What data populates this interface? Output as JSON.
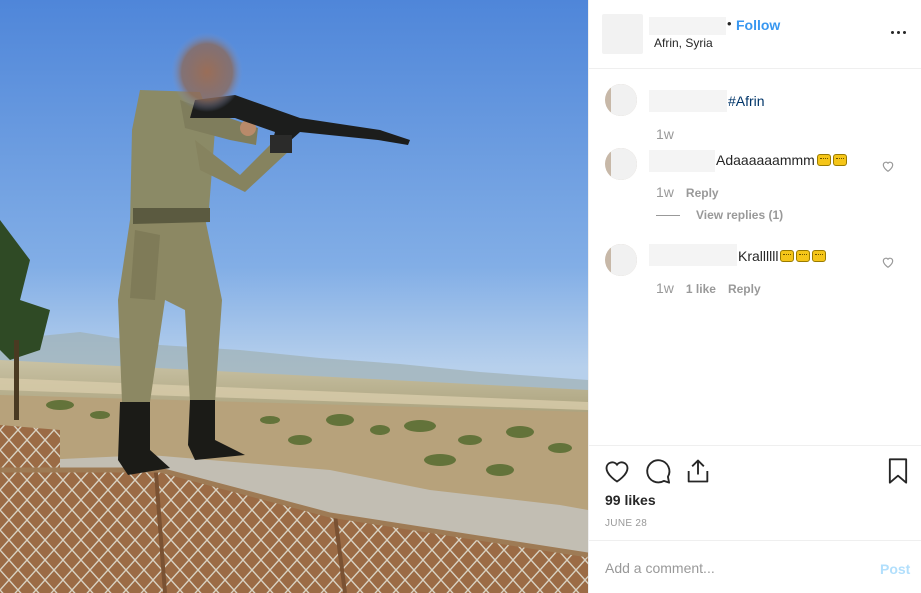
{
  "post": {
    "image": {
      "description_icon": "photo"
    }
  },
  "header": {
    "separator": "•",
    "follow_label": "Follow",
    "location": "Afrin, Syria",
    "more_icon": "more-horizontal-icon"
  },
  "comments": [
    {
      "text": "#Afrin",
      "time": "1w"
    },
    {
      "text": "Adaaaaaammm",
      "emoji_count": 2,
      "time": "1w",
      "reply_label": "Reply",
      "view_replies_label": "View replies (1)"
    },
    {
      "text": "Krallllll",
      "emoji_count": 3,
      "time": "1w",
      "likes_label": "1 like",
      "reply_label": "Reply"
    }
  ],
  "actions": {
    "icons": [
      "heart-icon",
      "comment-icon",
      "share-icon",
      "bookmark-icon"
    ],
    "likes_text": "99 likes",
    "date_text": "JUNE 28"
  },
  "add_comment": {
    "placeholder": "Add a comment...",
    "post_label": "Post"
  },
  "colors": {
    "accent": "#3897f0",
    "post_disabled": "#b2dffc",
    "muted_text": "#999999"
  }
}
